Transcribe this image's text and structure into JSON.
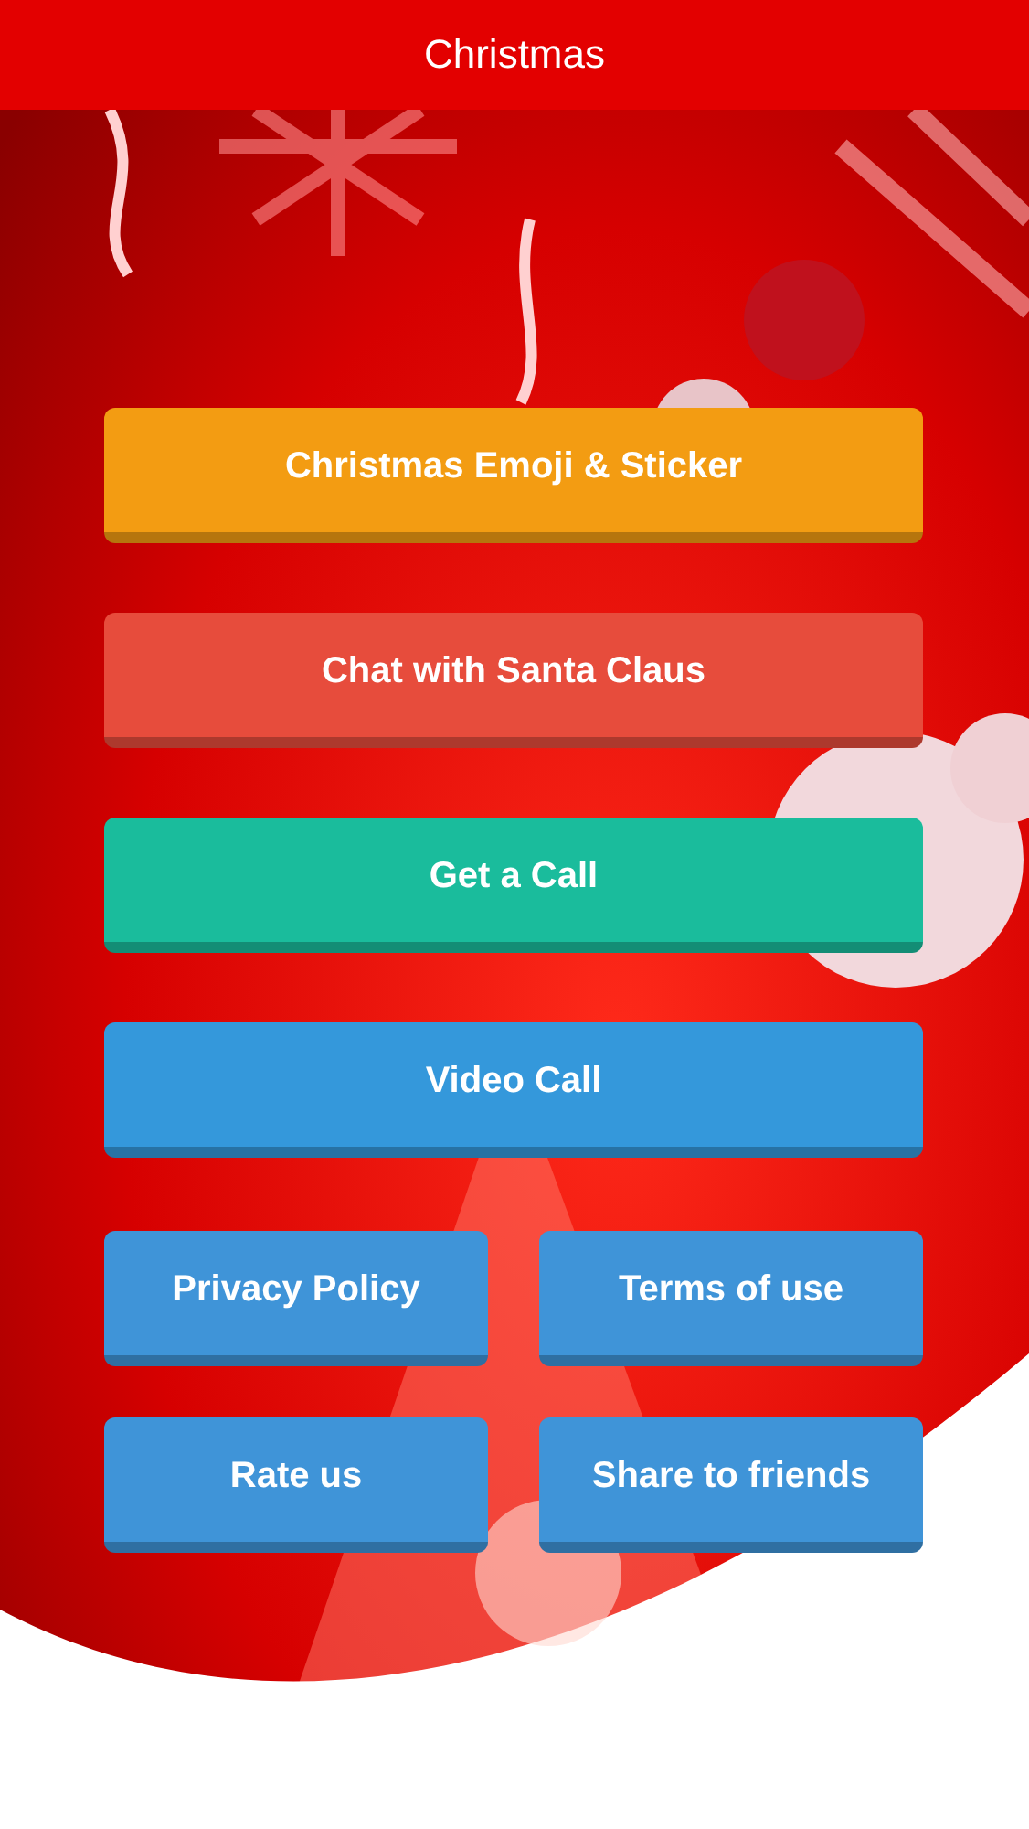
{
  "header": {
    "title": "Christmas"
  },
  "main_buttons": [
    {
      "label": "Christmas Emoji & Sticker",
      "color": "#f39c12"
    },
    {
      "label": "Chat with Santa Claus",
      "color": "#e74c3c"
    },
    {
      "label": "Get a Call",
      "color": "#1abc9c"
    },
    {
      "label": "Video Call",
      "color": "#3498db"
    }
  ],
  "small_buttons": [
    {
      "label": "Privacy Policy",
      "color": "#3f94d8"
    },
    {
      "label": "Terms of use",
      "color": "#3f94d8"
    },
    {
      "label": "Rate us",
      "color": "#3f94d8"
    },
    {
      "label": "Share to friends",
      "color": "#3f94d8"
    }
  ]
}
